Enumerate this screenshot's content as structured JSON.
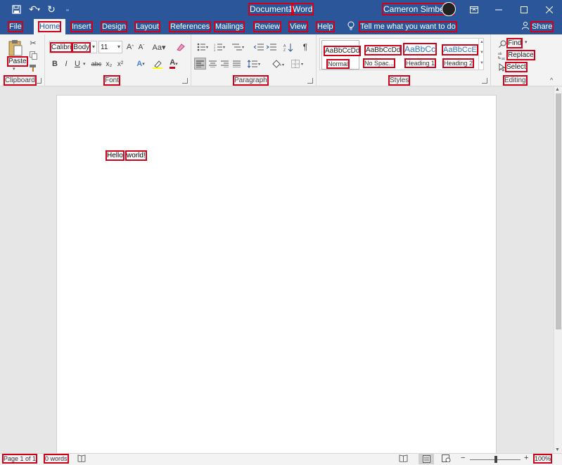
{
  "titlebar": {
    "document_name": "Document1",
    "separator": "-",
    "app_name": "Word",
    "user_name": "Cameron Simbeck",
    "quick_access": [
      "save-icon",
      "undo-icon",
      "redo-icon",
      "customize-icon"
    ],
    "window_controls": [
      "ribbon-options-icon",
      "minimize-icon",
      "maximize-icon",
      "close-icon"
    ]
  },
  "tabs": [
    {
      "label": "File"
    },
    {
      "label": "Home",
      "active": true
    },
    {
      "label": "Insert"
    },
    {
      "label": "Design"
    },
    {
      "label": "Layout"
    },
    {
      "label": "References"
    },
    {
      "label": "Mailings"
    },
    {
      "label": "Review"
    },
    {
      "label": "View"
    },
    {
      "label": "Help"
    }
  ],
  "tell_me": "Tell me what you want to do",
  "share": "Share",
  "ribbon": {
    "clipboard": {
      "label": "Clipboard",
      "paste": "Paste"
    },
    "font": {
      "label": "Font",
      "font_name": "Calibri",
      "font_theme": "Body",
      "font_size": "11",
      "bold": "B",
      "italic": "I",
      "underline": "U",
      "strike": "abc",
      "sub": "x₂",
      "sup": "x²"
    },
    "paragraph": {
      "label": "Paragraph"
    },
    "styles": {
      "label": "Styles",
      "items": [
        {
          "sample": "AaBbCcDd",
          "name": "Normal"
        },
        {
          "sample": "AaBbCcDd",
          "name": "No Spac..."
        },
        {
          "sample": "AaBbCc",
          "name": "Heading 1"
        },
        {
          "sample": "AaBbCcE",
          "name": "Heading 2"
        }
      ]
    },
    "editing": {
      "label": "Editing",
      "find": "Find",
      "replace": "Replace",
      "select": "Select"
    }
  },
  "document": {
    "words": [
      "Hello",
      "world!"
    ]
  },
  "statusbar": {
    "page": "Page 1 of 1",
    "words": "0 words",
    "zoom": "100%",
    "zoom_minus": "−",
    "zoom_plus": "+"
  },
  "colors": {
    "brand": "#2b579a",
    "highlight": "#d0021b"
  }
}
